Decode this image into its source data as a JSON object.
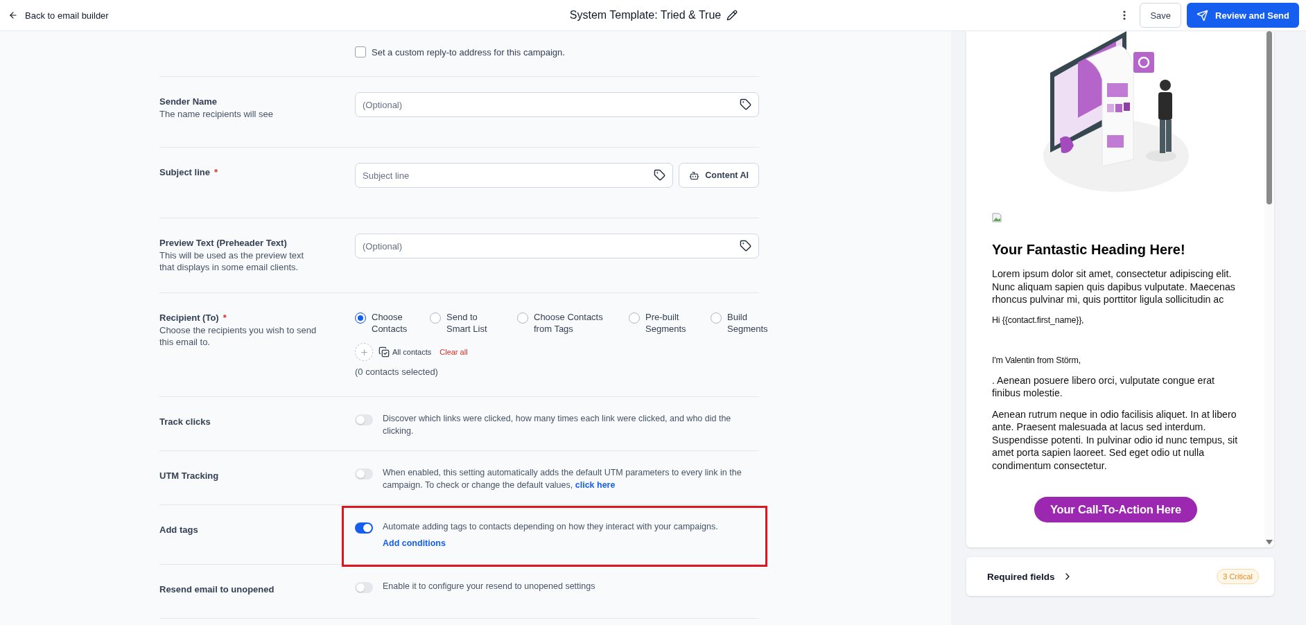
{
  "header": {
    "back": "Back to email builder",
    "title": "System Template: Tried & True",
    "save": "Save",
    "review": "Review and Send"
  },
  "form": {
    "reply_to": {
      "label": "Set a custom reply-to address for this campaign.",
      "checked": false
    },
    "rows": [
      {
        "kind": "input",
        "label": "Sender Name",
        "hint": "The name recipients will see",
        "placeholder": "(Optional)"
      },
      {
        "kind": "input",
        "label": "Subject line",
        "required_mark": "*",
        "placeholder": "Subject line",
        "button": "Content AI"
      },
      {
        "kind": "input",
        "label": "Preview Text (Preheader Text)",
        "hint": "This will be used as the preview text that displays in some email clients.",
        "placeholder": "(Optional)"
      },
      {
        "kind": "recipients",
        "label": "Recipient (To)",
        "required_mark": "*",
        "hint": "Choose the recipients you wish to send this email to.",
        "options": [
          {
            "label": "Choose Contacts",
            "selected": true
          },
          {
            "label": "Send to Smart List",
            "selected": false
          },
          {
            "label": "Choose Contacts from Tags",
            "selected": false
          },
          {
            "label": "Pre-built Segments",
            "selected": false
          },
          {
            "label": "Build Segments",
            "selected": false
          }
        ],
        "all_contacts": "All contacts",
        "clear": "Clear all",
        "count": "(0 contacts selected)"
      },
      {
        "kind": "toggle",
        "label": "Track clicks",
        "on": false,
        "description": "Discover which links were clicked, how many times each link were clicked, and who did the clicking."
      },
      {
        "kind": "toggle",
        "label": "UTM Tracking",
        "on": false,
        "description": "When enabled, this setting automatically adds the default UTM parameters to every link in the campaign. To check or change the default values,",
        "link": "click here"
      },
      {
        "kind": "toggle",
        "label": "Add tags",
        "on": true,
        "highlighted": true,
        "description": "Automate adding tags to contacts depending on how they interact with your campaigns.",
        "action": "Add conditions"
      },
      {
        "kind": "toggle",
        "label": "Resend email to unopened",
        "on": false,
        "description": "Enable it to configure your resend to unopened settings"
      }
    ]
  },
  "preview": {
    "heading": "Your Fantastic Heading Here!",
    "paragraphs": [
      {
        "kind": "body",
        "text": "Lorem ipsum dolor sit amet, consectetur adipiscing elit. Nunc aliquam sapien quis dapibus vulputate. Maecenas rhoncus pulvinar mi, quis porttitor ligula sollicitudin ac"
      },
      {
        "kind": "greeting",
        "text": "Hi {{contact.first_name}},"
      },
      {
        "kind": "small",
        "text": "I'm Valentin from Störm,"
      },
      {
        "kind": "body",
        "text": ". Aenean posuere libero orci, vulputate congue erat finibus molestie."
      },
      {
        "kind": "body",
        "text": "Aenean rutrum neque in odio facilisis aliquet. In at libero ante. Praesent malesuada at lacus sed interdum. Suspendisse potenti. In pulvinar odio id nunc tempus, sit amet porta sapien laoreet. Sed eget odio ut nulla condimentum consectetur."
      }
    ],
    "cta": "Your Call-To-Action Here"
  },
  "required_fields": {
    "label": "Required fields",
    "badge": "3 Critical"
  }
}
